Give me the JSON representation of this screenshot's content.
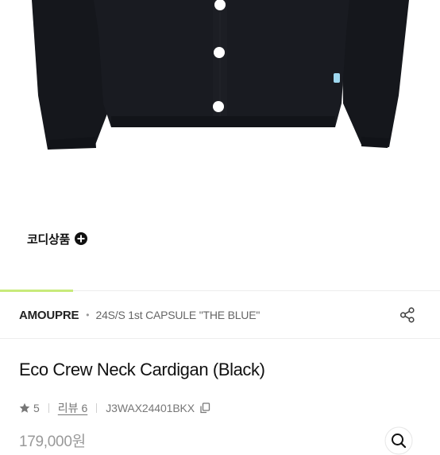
{
  "product": {
    "image_alt": "Black cardigan with white buttons",
    "coordi_label": "코디상품",
    "brand": "AMOUPRE",
    "collection": "24S/S 1st CAPSULE \"THE BLUE\"",
    "title": "Eco Crew Neck Cardigan (Black)",
    "rating": "5",
    "review_label": "리뷰 6",
    "sku": "J3WAX24401BKX",
    "price": "179,000원"
  },
  "colors": {
    "accent": "#c8ea7a",
    "garment": "#15171c",
    "button": "#ffffff",
    "tag": "#9fd8f0"
  },
  "icons": {
    "coordi": "plus-circle-icon",
    "share": "share-icon",
    "rating": "star-icon",
    "copy": "copy-icon",
    "search": "search-icon"
  }
}
